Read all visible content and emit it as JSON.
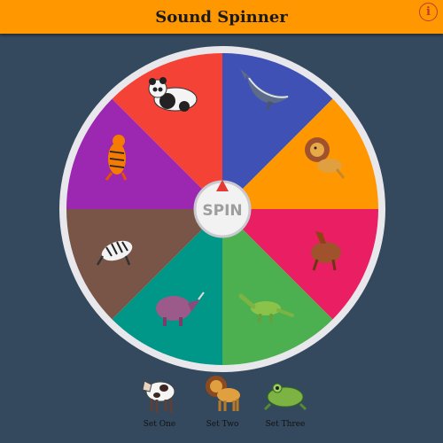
{
  "app": {
    "title": "Sound Spinner",
    "info_glyph": "i"
  },
  "wheel": {
    "center_label": "SPIN",
    "pointer_color": "#e53935",
    "segments": [
      {
        "animal": "whale",
        "color": "#3f51b5"
      },
      {
        "animal": "lion",
        "color": "#ff9800"
      },
      {
        "animal": "horse",
        "color": "#e91e63"
      },
      {
        "animal": "dinosaur",
        "color": "#4caf50"
      },
      {
        "animal": "rhino",
        "color": "#009688"
      },
      {
        "animal": "zebra",
        "color": "#795548"
      },
      {
        "animal": "tiger",
        "color": "#9c27b0"
      },
      {
        "animal": "panda",
        "color": "#f44336"
      }
    ]
  },
  "sets": [
    {
      "label": "Set One",
      "animal": "cow"
    },
    {
      "label": "Set Two",
      "animal": "lion"
    },
    {
      "label": "Set Three",
      "animal": "frog"
    }
  ],
  "colors": {
    "background": "#34495e",
    "header": "#ff9800"
  }
}
